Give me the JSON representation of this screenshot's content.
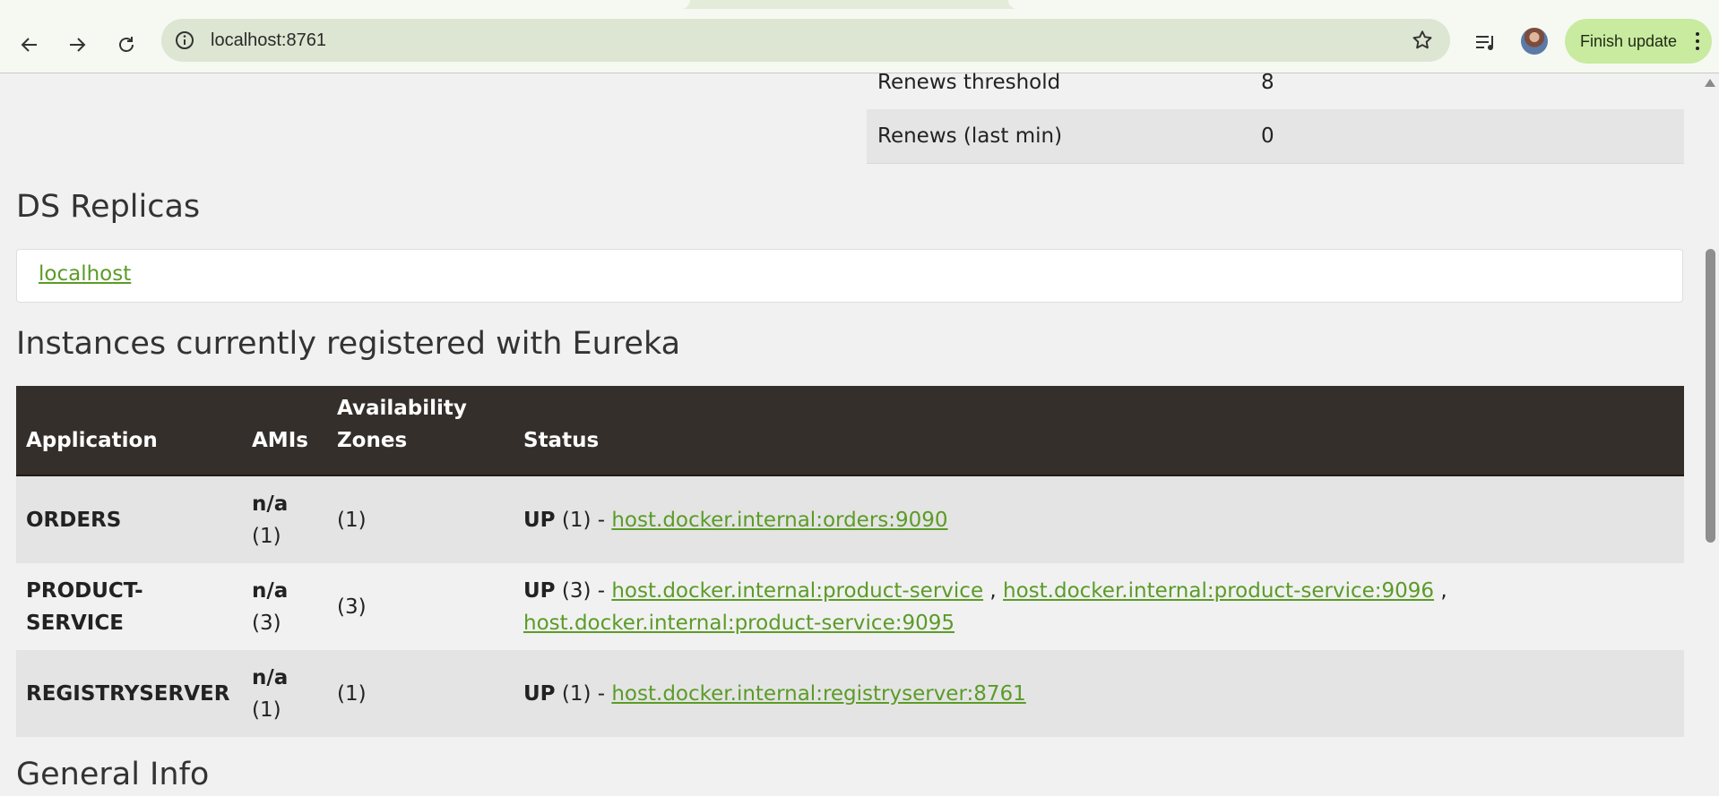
{
  "browser": {
    "url": "localhost:8761",
    "update_button_label": "Finish update",
    "icons": [
      "back-arrow-icon",
      "forward-arrow-icon",
      "reload-icon",
      "info-icon",
      "bookmark-star-icon",
      "media-queue-icon",
      "profile-avatar",
      "more-vert-icon"
    ]
  },
  "renews": [
    {
      "label": "Renews threshold",
      "value": "8"
    },
    {
      "label": "Renews (last min)",
      "value": "0"
    }
  ],
  "ds_replicas": {
    "heading": "DS Replicas",
    "link": "localhost"
  },
  "instances": {
    "heading": "Instances currently registered with Eureka",
    "headers": {
      "application": "Application",
      "amis": "AMIs",
      "zones_line1": "Availability",
      "zones_line2": "Zones",
      "status": "Status"
    },
    "rows": [
      {
        "app": "ORDERS",
        "amis": "n/a",
        "amis_count": "(1)",
        "zones": "(1)",
        "status_up": "UP",
        "status_count": " (1) - ",
        "links": [
          "host.docker.internal:orders:9090"
        ]
      },
      {
        "app_line1": "PRODUCT-",
        "app_line2": "SERVICE",
        "amis": "n/a",
        "amis_count": "(3)",
        "zones": "(3)",
        "status_up": "UP",
        "status_count": " (3) - ",
        "separator": " , ",
        "links": [
          "host.docker.internal:product-service",
          "host.docker.internal:product-service:9096",
          "host.docker.internal:product-service:9095"
        ]
      },
      {
        "app": "REGISTRYSERVER",
        "amis": "n/a",
        "amis_count": "(1)",
        "zones": "(1)",
        "status_up": "UP",
        "status_count": " (1) - ",
        "links": [
          "host.docker.internal:registryserver:8761"
        ]
      }
    ]
  },
  "general_info": {
    "heading": "General Info"
  },
  "colors": {
    "link": "#5b9b27",
    "table_header": "#342f2b",
    "page_bg": "#f1f1f1",
    "update_button": "#c8eba0"
  }
}
